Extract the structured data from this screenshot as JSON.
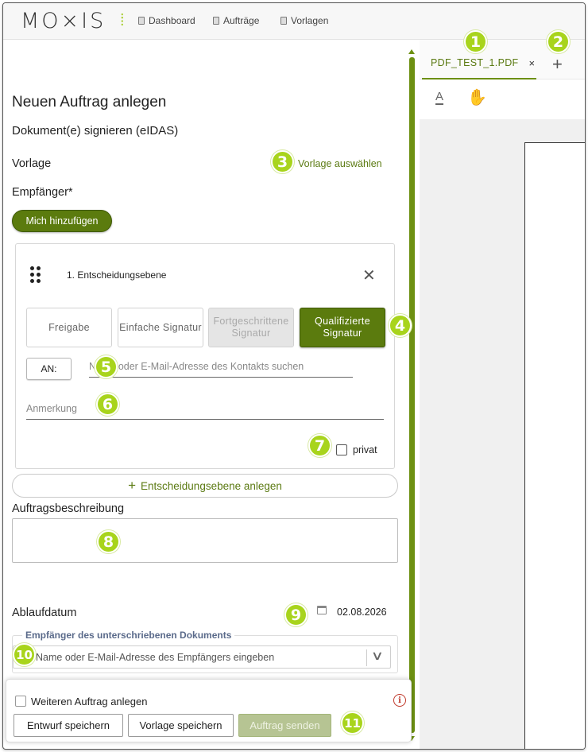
{
  "nav": {
    "logo": "MO⨯IS",
    "logo_mark": "⁞",
    "links": [
      "Dashboard",
      "Aufträge",
      "Vorlagen"
    ]
  },
  "form": {
    "title": "Neuen Auftrag anlegen",
    "subtitle": "Dokument(e) signieren (eIDAS)",
    "vorlage_label": "Vorlage",
    "vorlage_link": "Vorlage auswählen",
    "empfaenger_label": "Empfänger*",
    "mich_button": "Mich hinzufügen",
    "ebene": {
      "title": "1. Entscheidungsebene",
      "close": "✕",
      "types": [
        {
          "label": "Freigabe",
          "state": "normal"
        },
        {
          "label": "Einfache Signatur",
          "state": "normal"
        },
        {
          "label": "Fortgeschrittene Signatur",
          "state": "disabled"
        },
        {
          "label": "Qualifizierte Signatur",
          "state": "active"
        }
      ],
      "an_button": "AN:",
      "contact_placeholder": "Name oder E-Mail-Adresse des Kontakts suchen",
      "anmerkung_placeholder": "Anmerkung",
      "privat_label": "privat"
    },
    "add_ebene_button": "Entscheidungsebene anlegen",
    "beschreibung_label": "Auftragsbeschreibung",
    "ablauf_label": "Ablaufdatum",
    "ablauf_value": "02.08.2026",
    "empf_dok_legend": "Empfänger des unterschriebenen Dokuments",
    "empf_dok_placeholder": "Name oder E-Mail-Adresse des Empfängers eingeben"
  },
  "bottom": {
    "weiteren_label": "Weiteren Auftrag anlegen",
    "entwurf_button": "Entwurf speichern",
    "vorlage_button": "Vorlage speichern",
    "senden_button": "Auftrag senden",
    "info_icon": "i"
  },
  "viewer": {
    "tab_label": "PDF_TEST_1.PDF",
    "tab_close": "×",
    "add_tab": "+",
    "text_tool": "A",
    "hand_tool": "✋"
  },
  "badges": [
    "1",
    "2",
    "3",
    "4",
    "5",
    "6",
    "7",
    "8",
    "9",
    "10",
    "11"
  ],
  "colors": {
    "accent": "#5b7b0e",
    "badge": "#a8d41c",
    "scrollbar": "#6d9012"
  }
}
